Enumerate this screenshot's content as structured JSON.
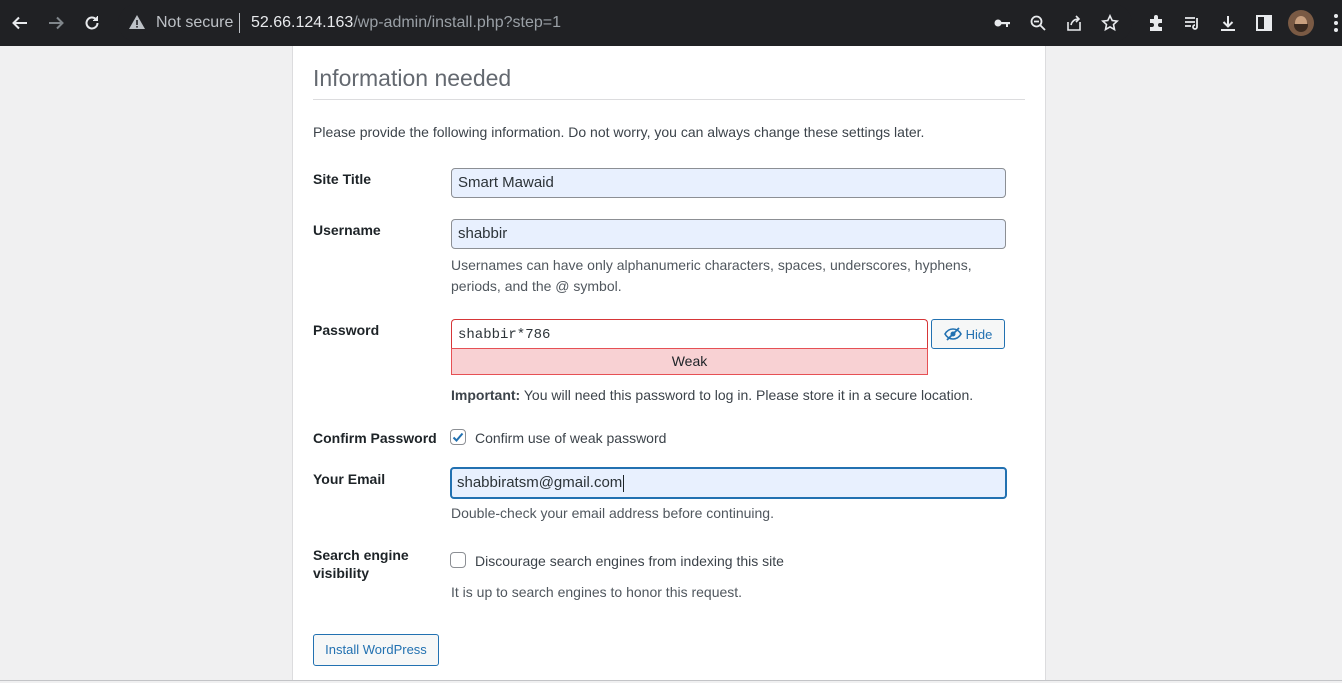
{
  "browser": {
    "security_label": "Not secure",
    "url_host": "52.66.124.163",
    "url_path": "/wp-admin/install.php?step=1"
  },
  "page": {
    "heading": "Information needed",
    "intro": "Please provide the following information. Do not worry, you can always change these settings later."
  },
  "form": {
    "site_title": {
      "label": "Site Title",
      "value": "Smart Mawaid"
    },
    "username": {
      "label": "Username",
      "value": "shabbir",
      "help_line1": "Usernames can have only alphanumeric characters, spaces, underscores, hyphens,",
      "help_line2": "periods, and the @ symbol."
    },
    "password": {
      "label": "Password",
      "value": "shabbir*786",
      "hide_label": "Hide",
      "strength": "Weak",
      "important_prefix": "Important:",
      "important_text": " You will need this password to log in. Please store it in a secure location."
    },
    "confirm_password": {
      "label": "Confirm Password",
      "checkbox_label": "Confirm use of weak password",
      "checked": true
    },
    "email": {
      "label": "Your Email",
      "value": "shabbiratsm@gmail.com",
      "help": "Double-check your email address before continuing."
    },
    "search_visibility": {
      "label_line1": "Search engine",
      "label_line2": "visibility",
      "checkbox_label": "Discourage search engines from indexing this site",
      "checked": false,
      "help": "It is up to search engines to honor this request."
    },
    "submit_label": "Install WordPress"
  },
  "colors": {
    "accent": "#2271b1",
    "error_border": "#d63638",
    "weak_bg": "#f8d1d3",
    "autofill_bg": "#e8f0fe"
  }
}
